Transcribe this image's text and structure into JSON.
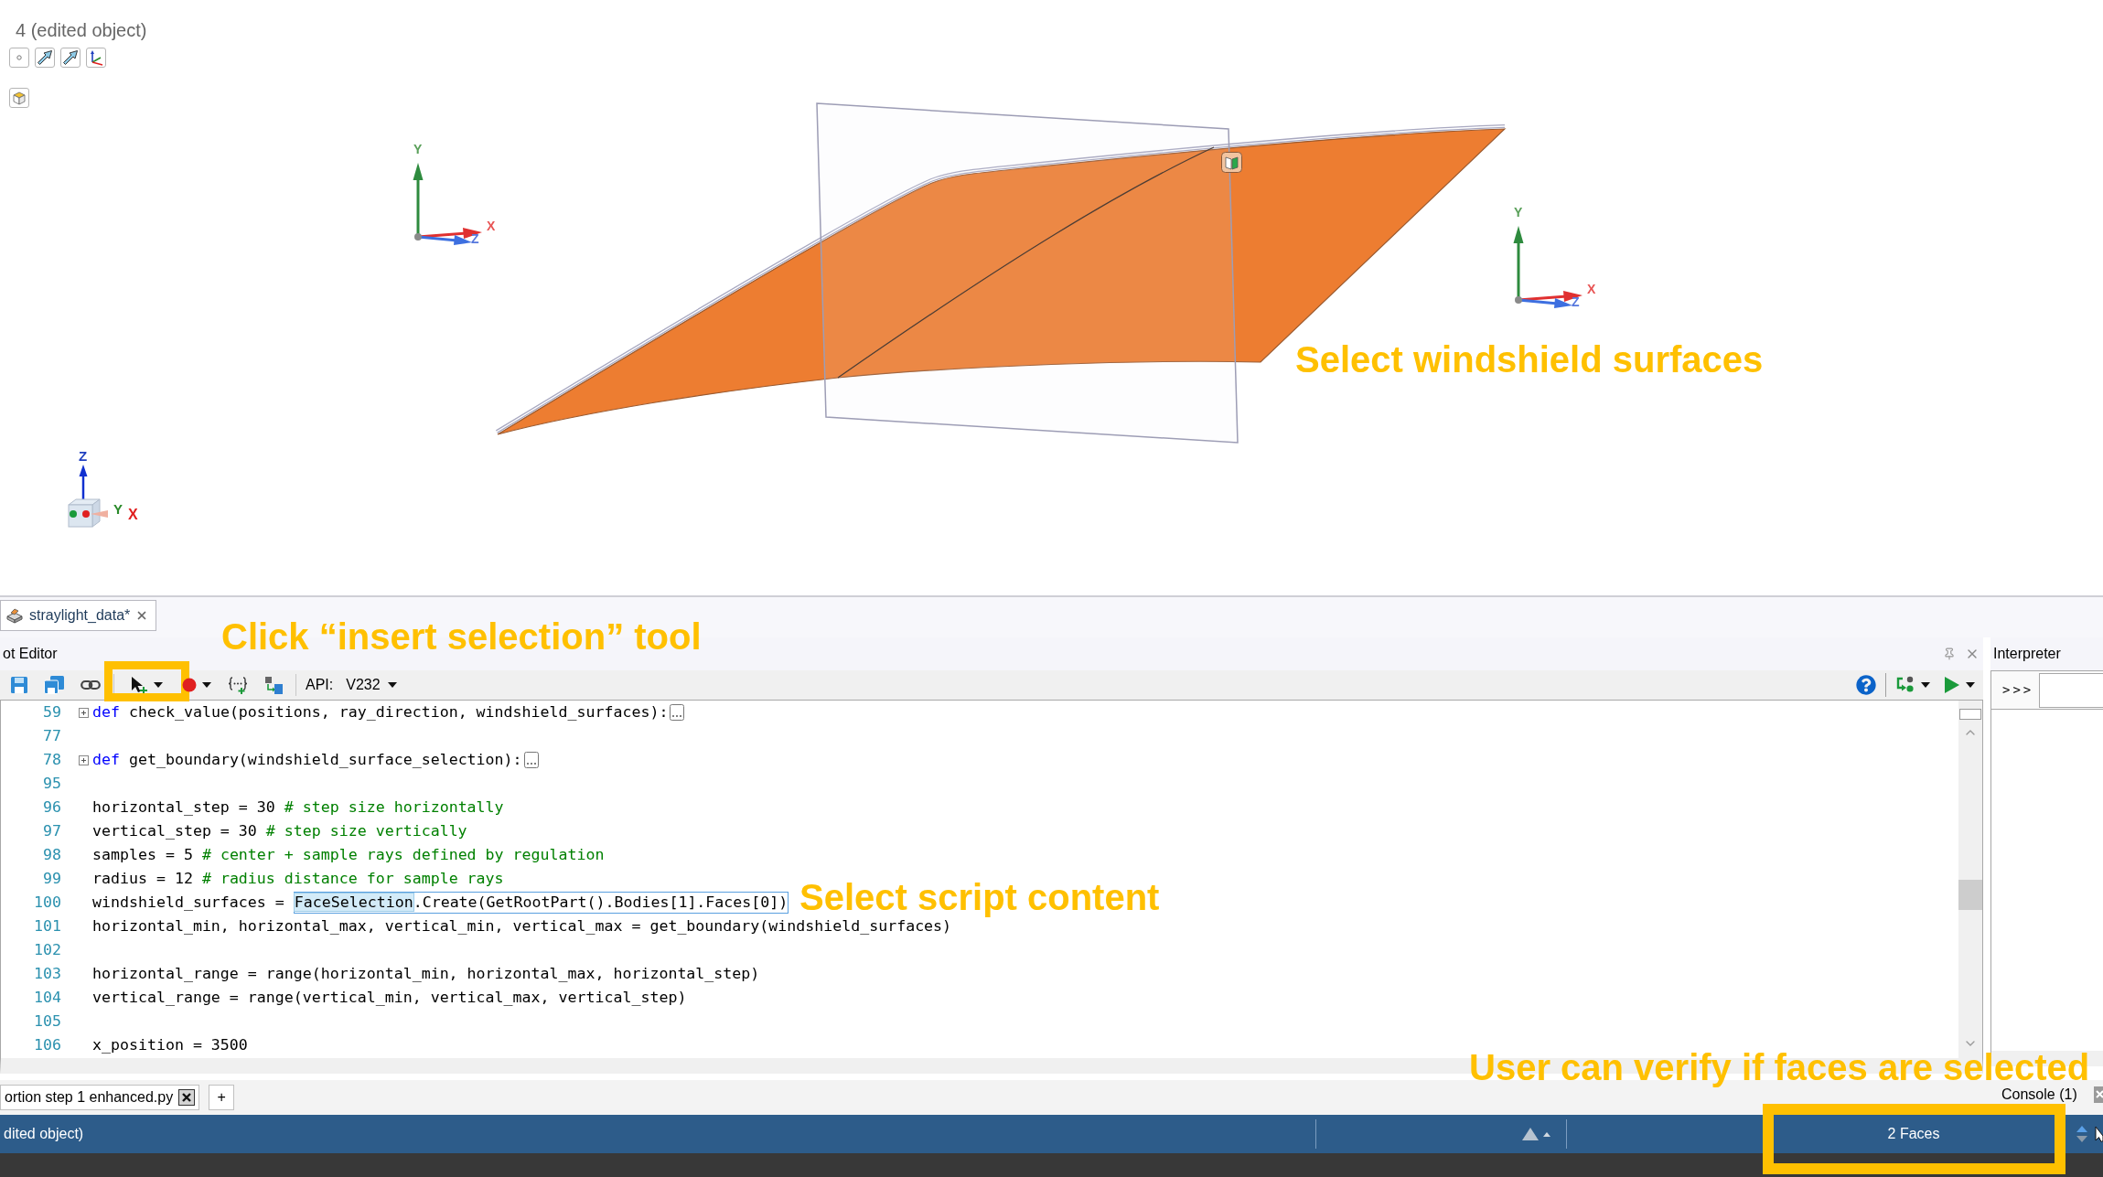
{
  "viewport": {
    "title": "4 (edited object)",
    "triads": [
      {
        "kind": "arrows",
        "vertical": "Y",
        "depth": "Z",
        "horizontal": "X"
      },
      {
        "kind": "arrows",
        "vertical": "Y",
        "depth": "Z",
        "horizontal": "X"
      },
      {
        "kind": "cube",
        "vertical": "Z",
        "depth": "Y",
        "horizontal": "X"
      }
    ]
  },
  "document_tabs": [
    {
      "label": "straylight_data*",
      "selected": true
    }
  ],
  "editor": {
    "title": "ot Editor",
    "toolbar": {
      "tools": [
        {
          "dropdown": false,
          "highlighted": false
        },
        {
          "dropdown": false,
          "highlighted": false
        },
        {
          "dropdown": false,
          "highlighted": false
        },
        {
          "dropdown": true,
          "highlighted": true
        },
        {
          "dropdown": true,
          "highlighted": false
        },
        {
          "dropdown": false,
          "highlighted": false
        },
        {
          "dropdown": false,
          "highlighted": false
        }
      ],
      "api_label": "API:",
      "api_version": "V232",
      "right_tools": [
        {
          "dropdown": false
        },
        {
          "dropdown": true
        },
        {
          "dropdown": true
        }
      ]
    },
    "lines": [
      {
        "kind": "folded",
        "number": "59",
        "keyword": "def",
        "code": "check_value(positions, ray_direction, windshield_surfaces):"
      },
      {
        "kind": "blank",
        "number": "77"
      },
      {
        "kind": "folded",
        "number": "78",
        "keyword": "def",
        "code": "get_boundary(windshield_surface_selection):"
      },
      {
        "kind": "blank",
        "number": "95"
      },
      {
        "kind": "code",
        "number": "96",
        "code": "horizontal_step = 30",
        "comment": "# step size horizontally"
      },
      {
        "kind": "code",
        "number": "97",
        "code": "vertical_step = 30",
        "comment": "# step size vertically"
      },
      {
        "kind": "code",
        "number": "98",
        "code": "samples = 5",
        "comment": "# center + sample rays defined by regulation"
      },
      {
        "kind": "code",
        "number": "99",
        "code": "radius = 12",
        "comment": "# radius distance for sample rays"
      },
      {
        "kind": "selection",
        "number": "100",
        "code": "windshield_surfaces =",
        "selected": "FaceSelection",
        "code_after": ".Create(GetRootPart().Bodies[1].Faces[0])"
      },
      {
        "kind": "code",
        "number": "101",
        "code": "horizontal_min, horizontal_max, vertical_min, vertical_max = get_boundary(windshield_surfaces)"
      },
      {
        "kind": "blank",
        "number": "102"
      },
      {
        "kind": "code",
        "number": "103",
        "code": "horizontal_range = range(horizontal_min, horizontal_max, horizontal_step)"
      },
      {
        "kind": "code",
        "number": "104",
        "code": "vertical_range = range(vertical_min, vertical_max, vertical_step)"
      },
      {
        "kind": "blank",
        "number": "105"
      },
      {
        "kind": "code",
        "number": "106",
        "code": "x_position = 3500"
      }
    ]
  },
  "interpreter": {
    "title": "Interpreter",
    "prompt": ">>>",
    "console_tab": "Console (1)"
  },
  "script_tabs": [
    {
      "label": "ortion step 1 enhanced.py",
      "selected": true
    }
  ],
  "new_tab_button": "+",
  "status_bar": {
    "text": "dited object)",
    "selection": "2 Faces",
    "selection_highlighted": true
  },
  "annotations": [
    {
      "text": "Select windshield surfaces"
    },
    {
      "text": "Click “insert selection” tool"
    },
    {
      "text": "Select script content"
    },
    {
      "text": "User can verify if faces are selected"
    }
  ]
}
